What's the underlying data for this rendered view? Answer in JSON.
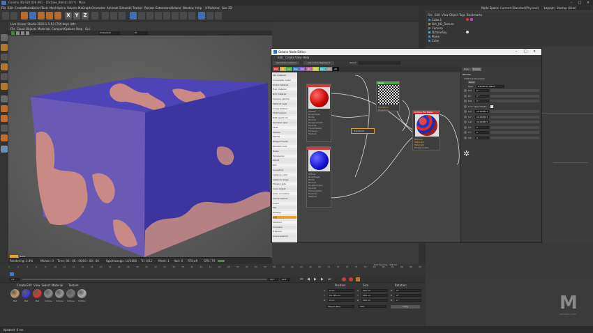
{
  "window": {
    "title": "Cinema 4D R20.026 (RC) - [Octane_Blend.c4d *] - Main",
    "controls": [
      "–",
      "□",
      "×"
    ]
  },
  "menubar": {
    "items": [
      "File",
      "Edit",
      "Create",
      "Modes",
      "Select",
      "Tools",
      "Mesh",
      "Spline",
      "Volume",
      "MoGraph",
      "Character",
      "Animate",
      "Simulate",
      "Tracker",
      "Render",
      "Extensions",
      "Octane",
      "Window",
      "Help",
      "X-Particles",
      "Gas 3D"
    ],
    "node_space_label": "Node Space:",
    "node_space_value": "Current (Standard/Physical)",
    "layout_label": "Layout:",
    "layout_value": "Startup (User)"
  },
  "viewport": {
    "header": "Live Viewer Studio 2020.1.5-R3 (709 days left)",
    "menu": [
      "File",
      "Cloud",
      "Objects",
      "Materials",
      "Compare",
      "Options",
      "Help",
      "Gui"
    ],
    "toolbar_mode": "HDR/sRGB",
    "toolbar_value": "PT"
  },
  "render_info": {
    "status_label": "Rendering: 3.4%",
    "ms_sec": "Ms/sec: 0",
    "time": "Time: 00 : 00 : 00/00 : 00 : 00",
    "spp": "Spp/maxspp: 14/1000",
    "tri": "Tri: 0/12",
    "mesh": "Mesh: 1",
    "hair": "Hair: 0",
    "rtx": "RTX:off",
    "gpu": "GPU: 79",
    "progress": 0.034,
    "noise_label": "Noise"
  },
  "node_editor": {
    "title": "Octane Node Editor",
    "menu": [
      "Edit",
      "Create",
      "View",
      "Help"
    ],
    "buttons": [
      "Get Active material",
      "Get Active Tag/object"
    ],
    "search_label": "Search",
    "categories": [
      "Mat",
      "Tex",
      "Gen",
      "Map",
      "Oth",
      "Pro",
      "Emi",
      "Med",
      "C4D",
      "All"
    ],
    "category_colors": [
      "#c43b3b",
      "#d6a63a",
      "#4aa84a",
      "#3a78c4",
      "#8a5ac4",
      "#c45aa8",
      "#c4c43a",
      "#3ab4b4",
      "#888888",
      "#111111"
    ],
    "library": [
      "Mix material",
      "Composite mater",
      "Portal material",
      "Hair material",
      "Null material",
      "Shadow catcher",
      "Material layer",
      "Image texture",
      "Float texture",
      "RGB spectrum",
      "Gaussian spec",
      "Float",
      "Checks",
      "Marble",
      "Ridged Fractal",
      "Random color",
      "Noise",
      "Turbulence",
      "Falloff",
      "Dirt",
      "Curvature",
      "Instance color",
      "Instance range",
      "Polygon side",
      "Color Adjust",
      "Color correction",
      "Clamp texture",
      "Invert",
      "Mix",
      "Multiply",
      "Add",
      "Subtract",
      "Compare",
      "Triplanar",
      "Uvw transform"
    ],
    "nodes": {
      "mat_a": {
        "title": "Material",
        "ports": [
          "Diffuse",
          "Roughness",
          "Bump",
          "Normal",
          "Displacement",
          "Opacity",
          "Transmission",
          "Emission",
          "Medium"
        ]
      },
      "mat_b": {
        "title": "Material",
        "ports": [
          "Diffuse",
          "Roughness",
          "Bump",
          "Normal",
          "Displacement",
          "Opacity",
          "Transmission",
          "Emission",
          "Medium"
        ]
      },
      "noise": {
        "title": "Noise",
        "ports": [
          "Transform",
          "Projection"
        ]
      },
      "transform": {
        "title": "Transform"
      },
      "mix": {
        "title": "Octane Mix Mater",
        "ports": [
          "Amount",
          "Material1",
          "Material2",
          "Displacement"
        ]
      }
    },
    "props": {
      "tabs": [
        "Basic",
        "Shader"
      ],
      "section": "Shader",
      "subsection": "UVW transformation",
      "reset_label": "Reset",
      "type_label": "Type",
      "type_value": "Transform Value",
      "rows": [
        {
          "label": "R.X",
          "value": "0 °"
        },
        {
          "label": "R.Y",
          "value": "0 °"
        },
        {
          "label": "R.Z",
          "value": "0 °"
        },
        {
          "label": "Lock Aspect Ratio",
          "value": ""
        },
        {
          "label": "S.X",
          "value": "10.408317"
        },
        {
          "label": "S.Y",
          "value": "10.408317"
        },
        {
          "label": "S.Z",
          "value": "10.408317"
        },
        {
          "label": "T.X",
          "value": "0"
        },
        {
          "label": "T.Y",
          "value": "0"
        },
        {
          "label": "T.Z",
          "value": "0"
        }
      ]
    }
  },
  "object_manager": {
    "menu": [
      "File",
      "Edit",
      "View",
      "Object",
      "Tags",
      "Bookmarks"
    ],
    "objects": [
      "Cube.1",
      "Oct_HD_Texture",
      "Camera",
      "OctaneSky",
      "Plane",
      "Cube"
    ]
  },
  "timeline": {
    "ticks": [
      "0",
      "2",
      "4",
      "6",
      "8",
      "10",
      "12",
      "14",
      "16",
      "18",
      "20",
      "22",
      "24",
      "26",
      "28",
      "30",
      "32",
      "34",
      "36",
      "38",
      "40",
      "42",
      "44",
      "46",
      "48",
      "50",
      "52",
      "54",
      "56",
      "58",
      "60",
      "62",
      "64",
      "66",
      "68",
      "70",
      "72",
      "74",
      "76",
      "78",
      "80",
      "82",
      "84",
      "86",
      "88",
      "90"
    ],
    "start": "0 F",
    "end": "90 F",
    "current": "90 F",
    "grid_spacing": "Grid Spacing : 100 cm"
  },
  "materials": {
    "menu": [
      "Create",
      "Edit",
      "View",
      "Select",
      "Material",
      "Texture"
    ],
    "items": [
      {
        "name": "Mat",
        "color": "#c8a070"
      },
      {
        "name": "Mat",
        "color": "#3a3ad8"
      },
      {
        "name": "Mat",
        "color": "#d83a3a"
      },
      {
        "name": "Octane",
        "color": "#8a8a8a"
      },
      {
        "name": "Octane",
        "color": "#9a9a9a"
      },
      {
        "name": "Octane",
        "color": "#777777"
      },
      {
        "name": "OctSky",
        "color": "#b0b0b0"
      }
    ]
  },
  "coords": {
    "headers": [
      "Position",
      "Size",
      "Rotation"
    ],
    "rows": [
      {
        "a": "X",
        "pos": "0 cm",
        "b": "X",
        "size": "200 cm",
        "c": "H",
        "rot": "0 °"
      },
      {
        "a": "Y",
        "pos": "93.795 cm",
        "b": "Y",
        "size": "200 cm",
        "c": "P",
        "rot": "0 °"
      },
      {
        "a": "Z",
        "pos": "0 cm",
        "b": "Z",
        "size": "200 cm",
        "c": "B",
        "rot": "0 °"
      }
    ],
    "mode_a": "Object (Rel)",
    "mode_b": "Size",
    "apply": "Apply"
  },
  "status": {
    "text": "Updated: 0 ms."
  },
  "watermark": {
    "letter": "M",
    "label": "MOTIONAL.COM"
  }
}
